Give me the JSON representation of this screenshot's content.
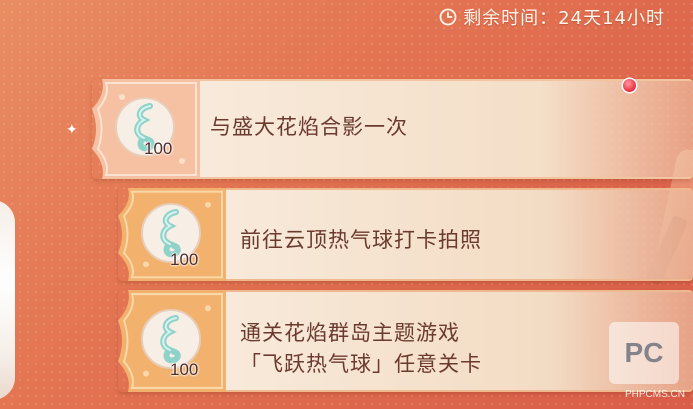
{
  "timer": {
    "icon": "clock-icon",
    "text": "剩余时间：24天14小时"
  },
  "tasks": [
    {
      "title": "与盛大花焰合影一次",
      "reward_icon": "music-note-crystal-icon",
      "reward_count": "100",
      "has_notification": true
    },
    {
      "title": "前往云顶热气球打卡拍照",
      "reward_icon": "music-note-crystal-icon",
      "reward_count": "100",
      "has_notification": false
    },
    {
      "title": "通关花焰群岛主题游戏「飞跃热气球」任意关卡",
      "reward_icon": "music-note-crystal-icon",
      "reward_count": "100",
      "has_notification": false
    }
  ],
  "watermark": {
    "logo": "PC",
    "text": "PHPCMS.CN"
  },
  "colors": {
    "background": "#e47653",
    "card": "#f8eadb",
    "badge_active": "#f6c1a3",
    "badge": "#f2b26e",
    "task_text": "#6b3a2e",
    "notification": "#f0384b"
  }
}
